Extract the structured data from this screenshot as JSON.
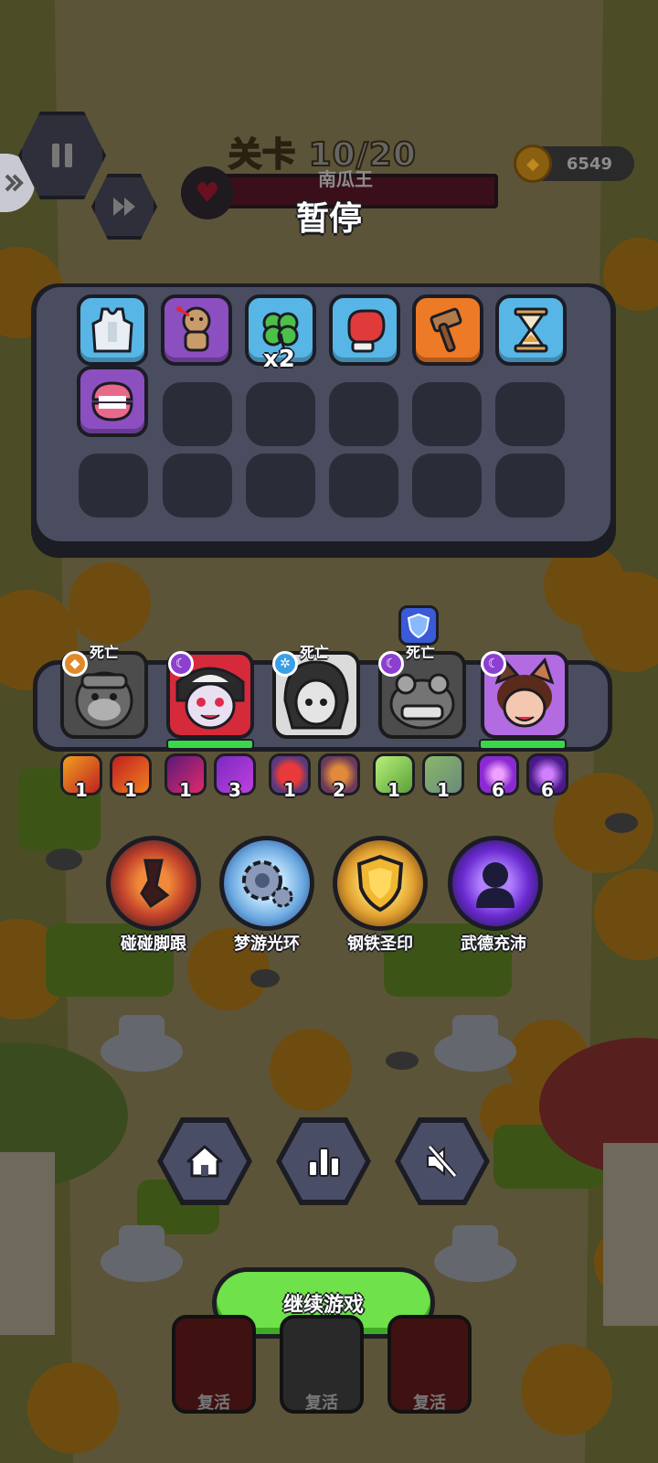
{
  "hud": {
    "level_label": "关卡",
    "level_value": "10/20",
    "boss_name": "南瓜王",
    "coins": "6549"
  },
  "pause": {
    "title": "暂停"
  },
  "inventory": {
    "items": [
      {
        "name": "vest",
        "color": "blue",
        "count": ""
      },
      {
        "name": "voodoo-doll",
        "color": "purple",
        "count": ""
      },
      {
        "name": "clover",
        "color": "blue",
        "count": "x2"
      },
      {
        "name": "boxing-glove",
        "color": "blue",
        "count": ""
      },
      {
        "name": "hammer",
        "color": "orange",
        "count": ""
      },
      {
        "name": "hourglass",
        "color": "blue",
        "count": ""
      },
      {
        "name": "denture",
        "color": "purple",
        "count": ""
      }
    ],
    "slot_count": 18
  },
  "heroes": [
    {
      "name": "monkey-hero",
      "status": "死亡",
      "badge": "orange"
    },
    {
      "name": "vampire-hero",
      "status": "",
      "badge": "purple"
    },
    {
      "name": "snow-girl-hero",
      "status": "死亡",
      "badge": "blue"
    },
    {
      "name": "frog-king-hero",
      "status": "死亡",
      "badge": "purple"
    },
    {
      "name": "cat-girl-hero",
      "status": "",
      "badge": "purple"
    }
  ],
  "skills": [
    {
      "name": "flame-punch",
      "level": "1"
    },
    {
      "name": "flame-slash",
      "level": "1"
    },
    {
      "name": "shadow-claw",
      "level": "1"
    },
    {
      "name": "bat-swarm",
      "level": "3"
    },
    {
      "name": "apple",
      "level": "1"
    },
    {
      "name": "fire-spirit",
      "level": "2"
    },
    {
      "name": "sword-throw",
      "level": "1"
    },
    {
      "name": "stone-shield",
      "level": "1"
    },
    {
      "name": "void-orb",
      "level": "6"
    },
    {
      "name": "void-burst",
      "level": "6"
    }
  ],
  "talents": [
    {
      "name": "bump-heel",
      "label": "碰碰脚跟"
    },
    {
      "name": "dream-halo",
      "label": "梦游光环"
    },
    {
      "name": "steel-seal",
      "label": "钢铁圣印"
    },
    {
      "name": "martial-vigor",
      "label": "武德充沛"
    }
  ],
  "menu": {
    "home": "home-icon",
    "stats": "stats-icon",
    "mute": "sound-off-icon"
  },
  "continue_label": "继续游戏",
  "revive": {
    "label": "复活",
    "labels": [
      "复活",
      "复活",
      "复活"
    ]
  },
  "colors": {
    "panel_outline": "#1c1c24",
    "panel_fill": "#4a4d60",
    "slot_empty": "#2a2c38",
    "continue_green": "#6fe14a",
    "hp_green": "#38d84a"
  }
}
